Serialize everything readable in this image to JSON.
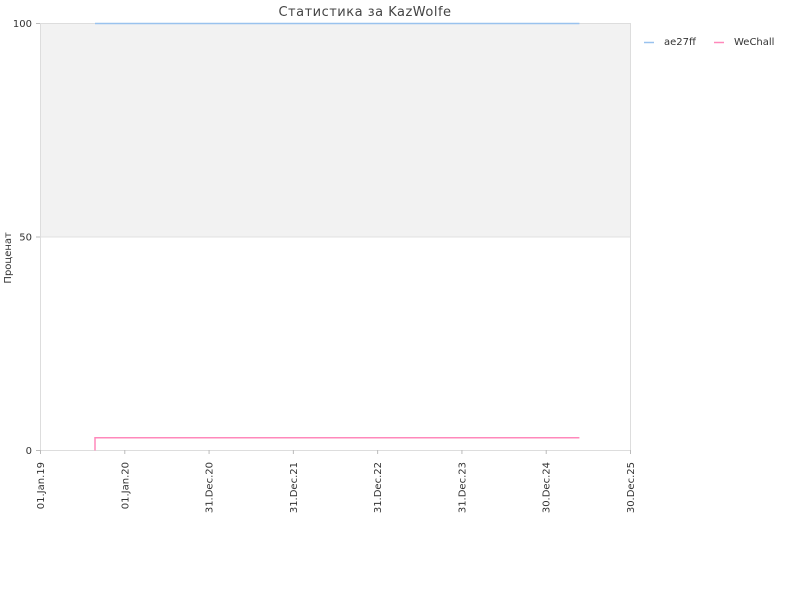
{
  "chart_data": {
    "type": "line",
    "title": "Статистика за KazWolfe",
    "xlabel": "",
    "ylabel": "Проценат",
    "x_tick_labels": [
      "01.Jan.19",
      "01.Jan.20",
      "31.Dec.20",
      "31.Dec.21",
      "31.Dec.22",
      "31.Dec.23",
      "30.Dec.24",
      "30.Dec.25"
    ],
    "y_tick_labels": [
      "0",
      "50",
      "100"
    ],
    "ylim": [
      0,
      100
    ],
    "grid": false,
    "legend_position": "top-right",
    "shaded_band": {
      "from": 50,
      "to": 100,
      "color": "#f2f2f2"
    },
    "series": [
      {
        "name": "ae27ff",
        "color": "#99c2ee",
        "points": [
          {
            "x": "2019-08-27",
            "y": 100
          },
          {
            "x": "2025-05-25",
            "y": 100
          }
        ]
      },
      {
        "name": "WeChall",
        "color": "#ff88bb",
        "points": [
          {
            "x": "2019-08-27",
            "y": 0
          },
          {
            "x": "2019-08-27",
            "y": 3
          },
          {
            "x": "2025-05-25",
            "y": 3
          }
        ]
      }
    ]
  }
}
